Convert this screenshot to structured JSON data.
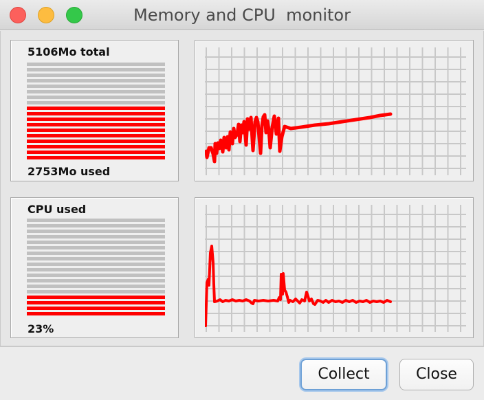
{
  "window": {
    "title": "Memory and CPU  monitor"
  },
  "memory": {
    "total_label": "5106Mo total",
    "used_label": "2753Mo used",
    "total_mo": 5106,
    "used_mo": 2753,
    "bar_count": 18,
    "lit_bars": 10
  },
  "cpu": {
    "title_label": "CPU used",
    "percent_label": "23%",
    "percent": 23,
    "bar_count": 18,
    "lit_bars": 4
  },
  "colors": {
    "accent": "#ff0000",
    "bar_off": "#c0c0c0",
    "grid": "#c8c8c8"
  },
  "buttons": {
    "collect": "Collect",
    "close": "Close"
  }
}
